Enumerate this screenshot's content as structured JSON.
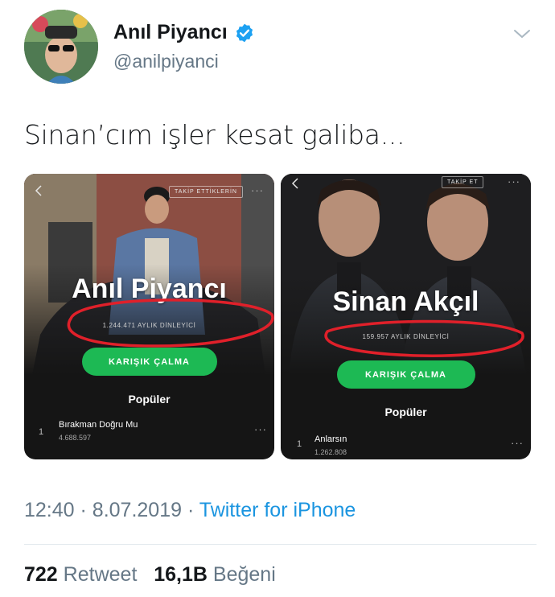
{
  "tweet": {
    "display_name": "Anıl Piyancı",
    "handle": "@anilpiyanci",
    "text": "Sinan’cım işler kesat galiba...",
    "time": "12:40",
    "separator": "·",
    "date": "8.07.2019",
    "source": "Twitter for iPhone",
    "retweets_count": "722",
    "retweets_label": "Retweet",
    "likes_count": "16,1B",
    "likes_label": "Beğeni"
  },
  "icons": {
    "verified": "verified-badge-icon",
    "caret": "chevron-down-icon",
    "back": "back-arrow-icon",
    "more": "more-dots-icon"
  },
  "colors": {
    "twitter_blue": "#1b95e0",
    "verified_blue": "#1da1f2",
    "spotify_green": "#1db954",
    "annotation_red": "#e0202a"
  },
  "cards": [
    {
      "artist": "Anıl Piyancı",
      "follow_label": "TAKİP ETTİKLERİN",
      "listeners": "1.244.471 AYLIK DİNLEYİCİ",
      "shuffle_label": "KARIŞIK ÇALMA",
      "popular_label": "Popüler",
      "track_number": "1",
      "track_title": "Bırakman Doğru Mu",
      "track_plays": "4.688.597",
      "more": "···"
    },
    {
      "artist": "Sinan Akçıl",
      "follow_label": "TAKİP ET",
      "listeners": "159.957 AYLIK DİNLEYİCİ",
      "shuffle_label": "KARIŞIK ÇALMA",
      "popular_label": "Popüler",
      "track_number": "1",
      "track_title": "Anlarsın",
      "track_plays": "1.262.808",
      "more": "···"
    }
  ]
}
